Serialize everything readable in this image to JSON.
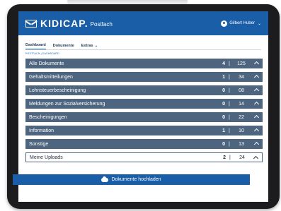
{
  "header": {
    "brand": "KIDICAP.",
    "brand_sub": "Postfach",
    "user_name": "Gilbert Huber"
  },
  "nav": {
    "tabs": [
      {
        "label": "Dashboard"
      },
      {
        "label": "Dokumente"
      },
      {
        "label": "Extras"
      }
    ]
  },
  "breadcrumb": "POSTFACH  |  DASHBOARD",
  "categories": [
    {
      "label": "Alle Dokumente",
      "count": "4",
      "sep": "|",
      "total": "125"
    },
    {
      "label": "Gehaltsmitteilungen",
      "count": "1",
      "sep": "|",
      "total": "34"
    },
    {
      "label": "Lohnsteuerbescheinigung",
      "count": "0",
      "sep": "|",
      "total": "08"
    },
    {
      "label": "Meldungen zur Sozialversicherung",
      "count": "0",
      "sep": "|",
      "total": "14"
    },
    {
      "label": "Bescheinigungen",
      "count": "0",
      "sep": "|",
      "total": "22"
    },
    {
      "label": "Information",
      "count": "1",
      "sep": "|",
      "total": "10"
    },
    {
      "label": "Sonstige",
      "count": "0",
      "sep": "|",
      "total": "13"
    },
    {
      "label": "Meine Uploads",
      "count": "2",
      "sep": "|",
      "total": "24"
    }
  ],
  "upload_button": "Dokumente hochladen"
}
